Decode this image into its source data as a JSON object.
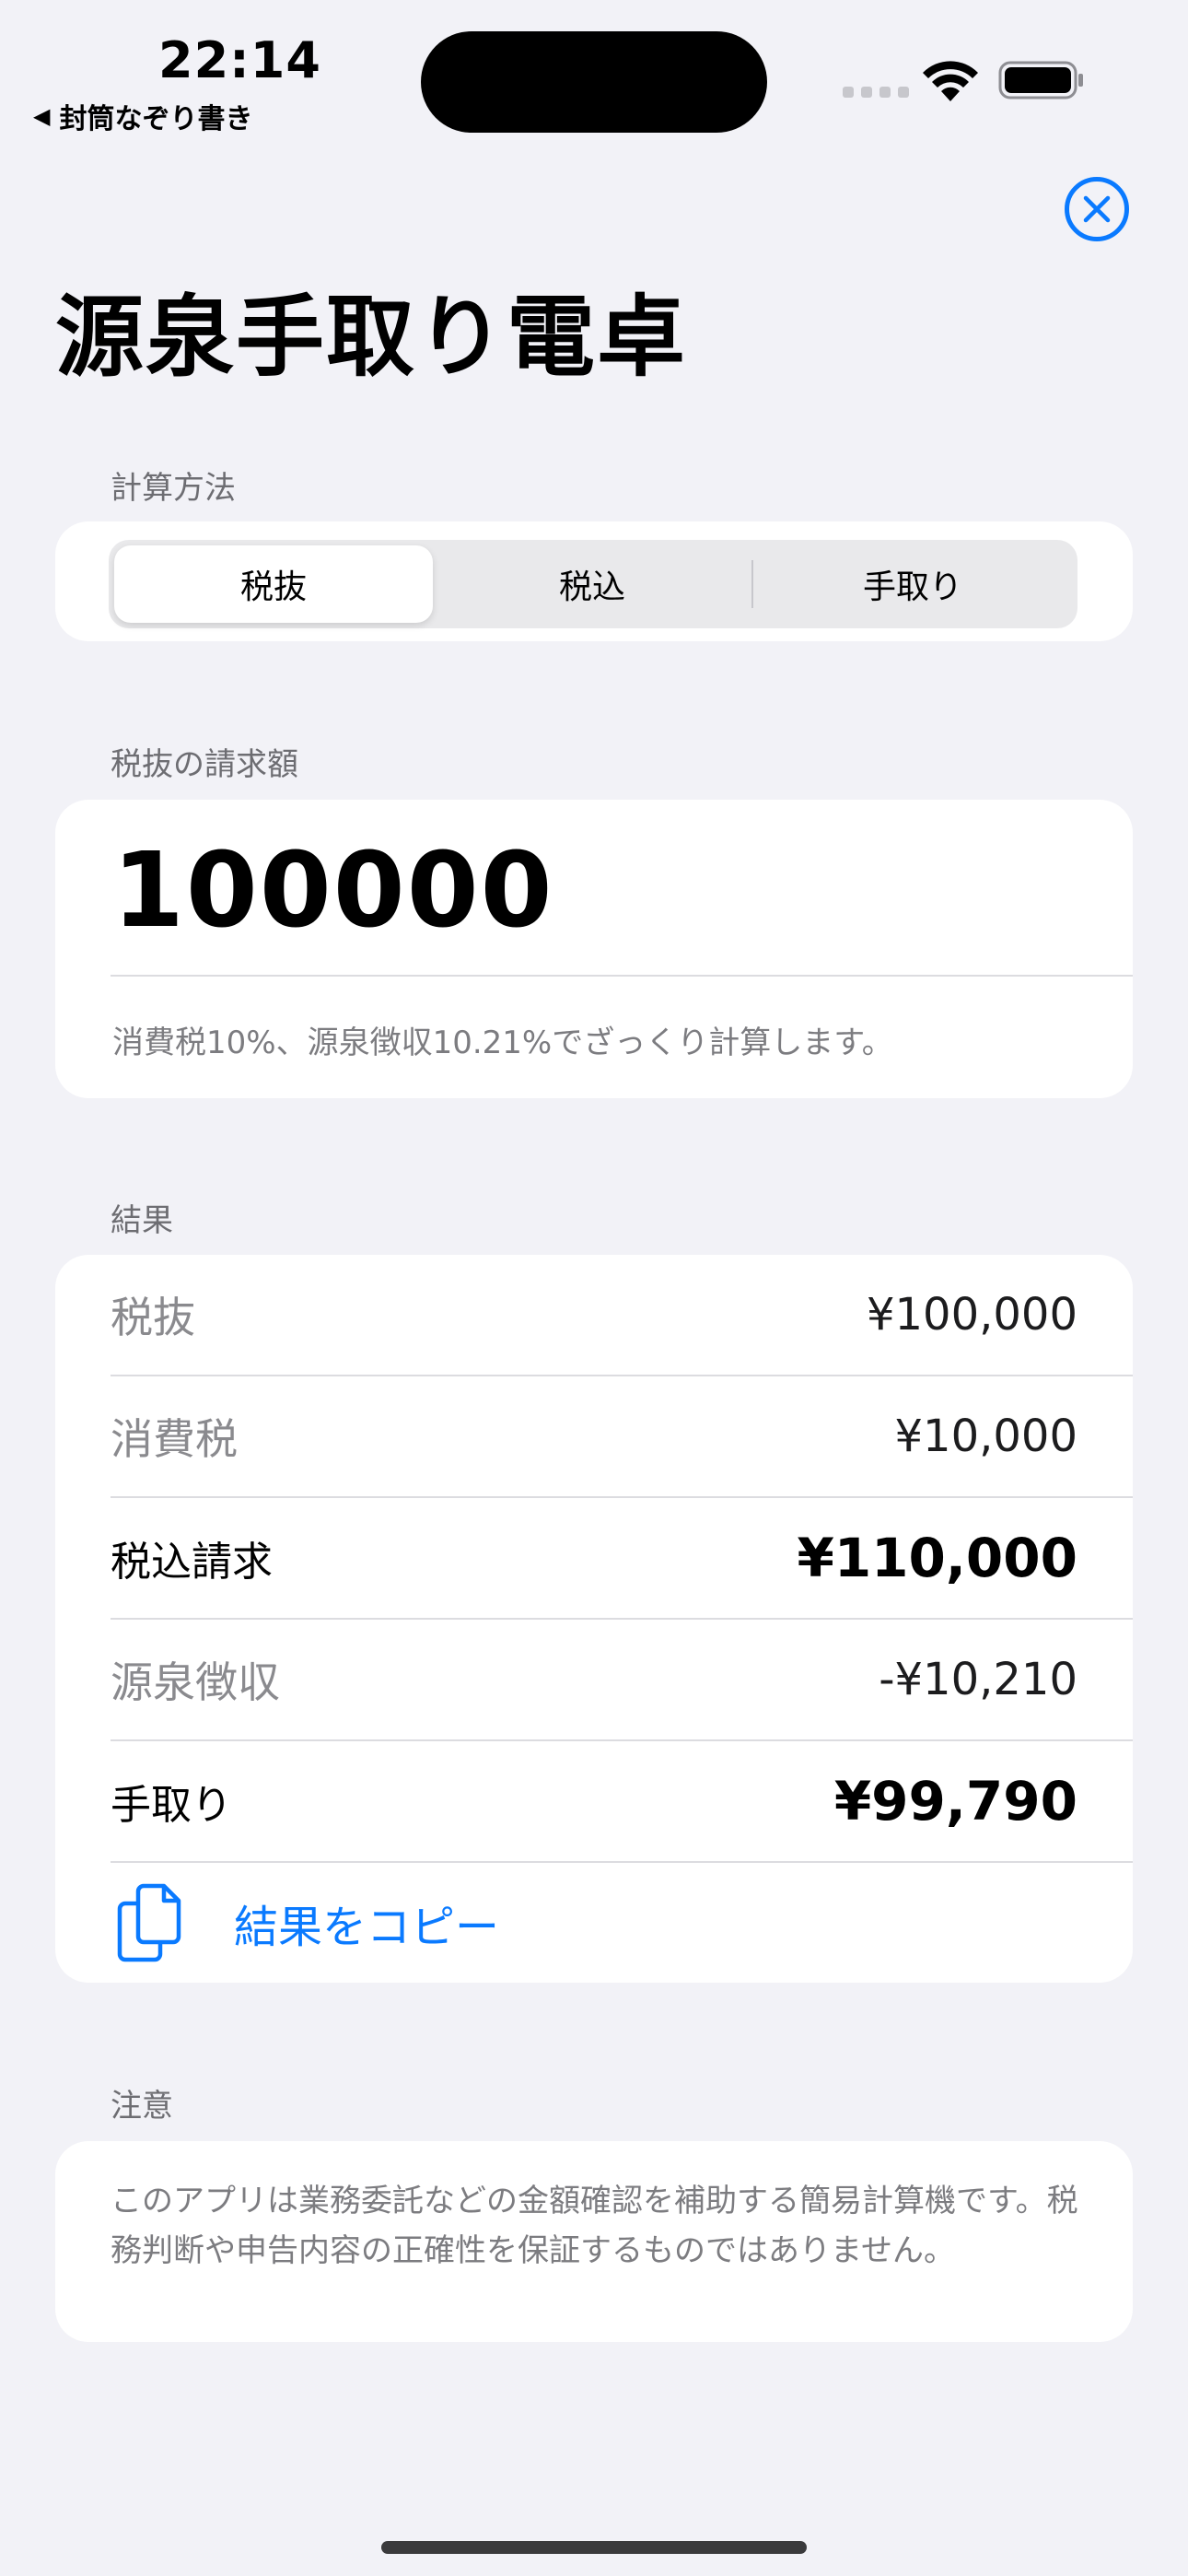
{
  "status_bar": {
    "time": "22:14",
    "back_app": "封筒なぞり書き"
  },
  "header": {
    "title": "源泉手取り電卓"
  },
  "method": {
    "section_label": "計算方法",
    "options": [
      "税抜",
      "税込",
      "手取り"
    ],
    "selected": "税抜"
  },
  "input": {
    "section_label": "税抜の請求額",
    "value": "100000",
    "note": "消費税10%、源泉徴収10.21%でざっくり計算します。"
  },
  "results": {
    "section_label": "結果",
    "rows": [
      {
        "label": "税抜",
        "value": "¥100,000"
      },
      {
        "label": "消費税",
        "value": "¥10,000"
      },
      {
        "label": "税込請求",
        "value": "¥110,000"
      },
      {
        "label": "源泉徴収",
        "value": "-¥10,210"
      },
      {
        "label": "手取り",
        "value": "¥99,790"
      }
    ],
    "copy_label": "結果をコピー"
  },
  "notice": {
    "section_label": "注意",
    "text": "このアプリは業務委託などの金額確認を補助する簡易計算機です。税務判断や申告内容の正確性を保証するものではありません。"
  },
  "colors": {
    "accent": "#0a7aff",
    "background": "#f2f2f7",
    "card": "#ffffff"
  },
  "icons": [
    "wifi-icon",
    "battery-icon",
    "close-icon",
    "copy-icon"
  ]
}
